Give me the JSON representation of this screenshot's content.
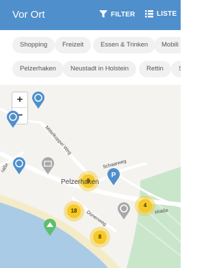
{
  "header": {
    "title": "Vor Ort",
    "filter_label": "FILTER",
    "list_label": "LISTE"
  },
  "categories": [
    "Shopping",
    "Freizeit",
    "Essen & Trinken",
    "Mobili"
  ],
  "places": [
    "Pelzerhaken",
    "Neustadt in Holstein",
    "Rettin",
    "S"
  ],
  "map": {
    "zoom_in": "+",
    "zoom_out": "−",
    "labels": {
      "town": "Pelzerhaken",
      "street_mittel": "Mittelkoppel Weg",
      "street_schaar": "Schaarweg",
      "street_dune": "Dünenweg",
      "street_strasse": "straße",
      "street_left": "raße"
    },
    "clusters": [
      "9",
      "4",
      "18",
      "8"
    ],
    "colors": {
      "header": "#4f8fcc",
      "cluster": "#f6c928",
      "water": "#a9cbe6",
      "beach": "#f4ecc9",
      "park": "#c9e6cb"
    }
  }
}
